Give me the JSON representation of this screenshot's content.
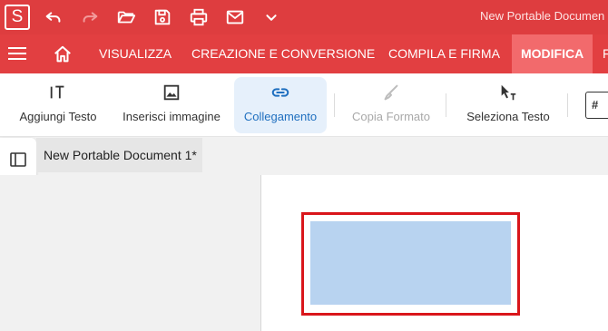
{
  "app": {
    "logo_letter": "S",
    "title": "New Portable Documen"
  },
  "quick_access": [
    "undo-icon",
    "redo-icon",
    "open-folder-icon",
    "save-icon",
    "print-icon",
    "mail-icon",
    "chevron-down-icon"
  ],
  "menu": {
    "items": [
      "VISUALIZZA",
      "CREAZIONE E CONVERSIONE",
      "COMPILA E FIRMA",
      "MODIFICA",
      "F"
    ],
    "active": "MODIFICA"
  },
  "toolbar": {
    "tools": [
      {
        "label": "Aggiungi Testo",
        "icon": "add-text-icon"
      },
      {
        "label": "Inserisci immagine",
        "icon": "image-icon"
      },
      {
        "label": "Collegamento",
        "icon": "link-icon",
        "state": "active"
      },
      {
        "label": "Copia Formato",
        "icon": "format-brush-icon",
        "state": "disabled"
      },
      {
        "label": "Seleziona Testo",
        "icon": "select-text-icon"
      }
    ]
  },
  "document": {
    "tab_title": "New Portable Document 1*"
  },
  "colors": {
    "title_bar": "#de3d3f",
    "menu_bar": "#e23f41",
    "active_menu": "#f26a6c",
    "link_border": "#d9161b",
    "link_fill": "#b8d3f0",
    "active_tool_bg": "#e6f0fb",
    "active_tool_text": "#1f6fbf"
  }
}
